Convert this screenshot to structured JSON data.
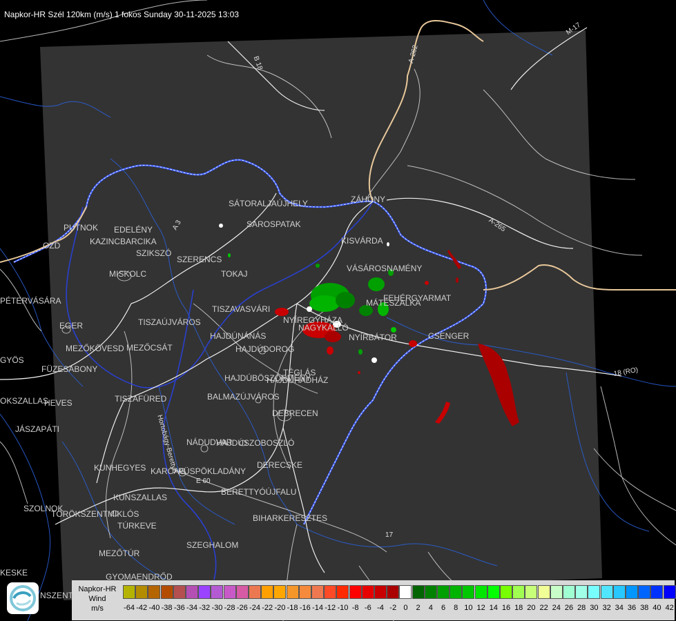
{
  "title": "Napkor-HR Szél 120km (m/s) 1 fokos Sunday 30-11-2025 13:03",
  "legend": {
    "name_lines": [
      "Napkor-HR",
      "Wind",
      "m/s"
    ],
    "ticks": [
      "-64",
      "-42",
      "-40",
      "-38",
      "-36",
      "-34",
      "-32",
      "-30",
      "-28",
      "-26",
      "-24",
      "-22",
      "-20",
      "-18",
      "-16",
      "-14",
      "-12",
      "-10",
      "-8",
      "-6",
      "-4",
      "-2",
      "0",
      "2",
      "4",
      "6",
      "8",
      "10",
      "12",
      "14",
      "16",
      "18",
      "20",
      "22",
      "24",
      "26",
      "28",
      "30",
      "32",
      "34",
      "36",
      "38",
      "40",
      "42"
    ],
    "colors": [
      "#b4b400",
      "#b48c00",
      "#b46400",
      "#b44c00",
      "#b45050",
      "#b450b4",
      "#9a44ff",
      "#b45ad2",
      "#c85ac8",
      "#d75aa5",
      "#eb7850",
      "#ffa000",
      "#ffa600",
      "#f5962a",
      "#f58a3c",
      "#f07850",
      "#ff4a28",
      "#ff2a00",
      "#ff0000",
      "#e60000",
      "#c80000",
      "#aa0000",
      "#ffffff",
      "#006400",
      "#008200",
      "#00a000",
      "#00b400",
      "#00c800",
      "#00e600",
      "#00ff00",
      "#78ff00",
      "#a0ff50",
      "#c8ff78",
      "#f0ff96",
      "#c8ffc8",
      "#a0ffd2",
      "#a0ffe6",
      "#78ffff",
      "#50e6ff",
      "#28c8ff",
      "#0096ff",
      "#0064ff",
      "#0032ff",
      "#0000ff"
    ]
  },
  "cities": [
    {
      "name": "PUTNOK"
    },
    {
      "name": "EDELÉNY"
    },
    {
      "name": "KAZINCBARCIKA"
    },
    {
      "name": "SZIKSZÓ"
    },
    {
      "name": "MISKOLC"
    },
    {
      "name": "SZERENCS"
    },
    {
      "name": "TOKAJ"
    },
    {
      "name": "SÁTORALJAÚJHELY"
    },
    {
      "name": "SÁROSPATAK"
    },
    {
      "name": "ZÁHONY"
    },
    {
      "name": "KISVÁRDA"
    },
    {
      "name": "VÁSÁROSNAMÉNY"
    },
    {
      "name": "FEHÉRGYARMAT"
    },
    {
      "name": "MÁTÉSZALKA"
    },
    {
      "name": "CSENGER"
    },
    {
      "name": "NYÍREGYHÁZA"
    },
    {
      "name": "NAGYKÁLLÓ"
    },
    {
      "name": "NYÍRBÁTOR"
    },
    {
      "name": "TISZAVASVÁRI"
    },
    {
      "name": "TISZAÚJVÁROS"
    },
    {
      "name": "HAJDÚNÁNÁS"
    },
    {
      "name": "HAJDÚDOROG"
    },
    {
      "name": "EGER"
    },
    {
      "name": "MEZŐKÖVESD"
    },
    {
      "name": "MEZŐCSÁT"
    },
    {
      "name": "PÉTERVÁSÁRA"
    },
    {
      "name": "GYÖS"
    },
    {
      "name": "FÜZESABONY"
    },
    {
      "name": "TÉGLÁS"
    },
    {
      "name": "HAJDÚBÖSZÖRMÉNY"
    },
    {
      "name": "HAJDÚHADHÁZ"
    },
    {
      "name": "BALMAZÚJVÁROS"
    },
    {
      "name": "TISZAFÜRED"
    },
    {
      "name": "HEVES"
    },
    {
      "name": "JÁSZAPÁTI"
    },
    {
      "name": "DEBRECEN"
    },
    {
      "name": "NÁDUDVAR"
    },
    {
      "name": "HAJDÚSZOBOSZLÓ"
    },
    {
      "name": "DERECSKE"
    },
    {
      "name": "KUNHEGYES"
    },
    {
      "name": "KARCAG"
    },
    {
      "name": "PÜSPÖKLADÁNY"
    },
    {
      "name": "KUNSZALLAS"
    },
    {
      "name": "BERETTYÓÚJFALU"
    },
    {
      "name": "SZOLNOK"
    },
    {
      "name": "TÖRÖKSZENTMIKLÓS"
    },
    {
      "name": "BIHARKERESZTES"
    },
    {
      "name": "TÚRKEVE"
    },
    {
      "name": "SZEGHALOM"
    },
    {
      "name": "MEZŐTÚR"
    },
    {
      "name": "GYOMAENDRŐD"
    },
    {
      "name": "KESKE"
    },
    {
      "name": "NSZENTM"
    },
    {
      "name": "OZD"
    },
    {
      "name": "OKSZALLAS"
    }
  ],
  "roads": [
    {
      "name": "B 18"
    },
    {
      "name": "A-262"
    },
    {
      "name": "M-17"
    },
    {
      "name": "A-265"
    },
    {
      "name": "18 (RO)"
    },
    {
      "name": "A 3"
    },
    {
      "name": "E 60"
    },
    {
      "name": "17"
    },
    {
      "name": "Hortobágy-Berettyó"
    }
  ]
}
